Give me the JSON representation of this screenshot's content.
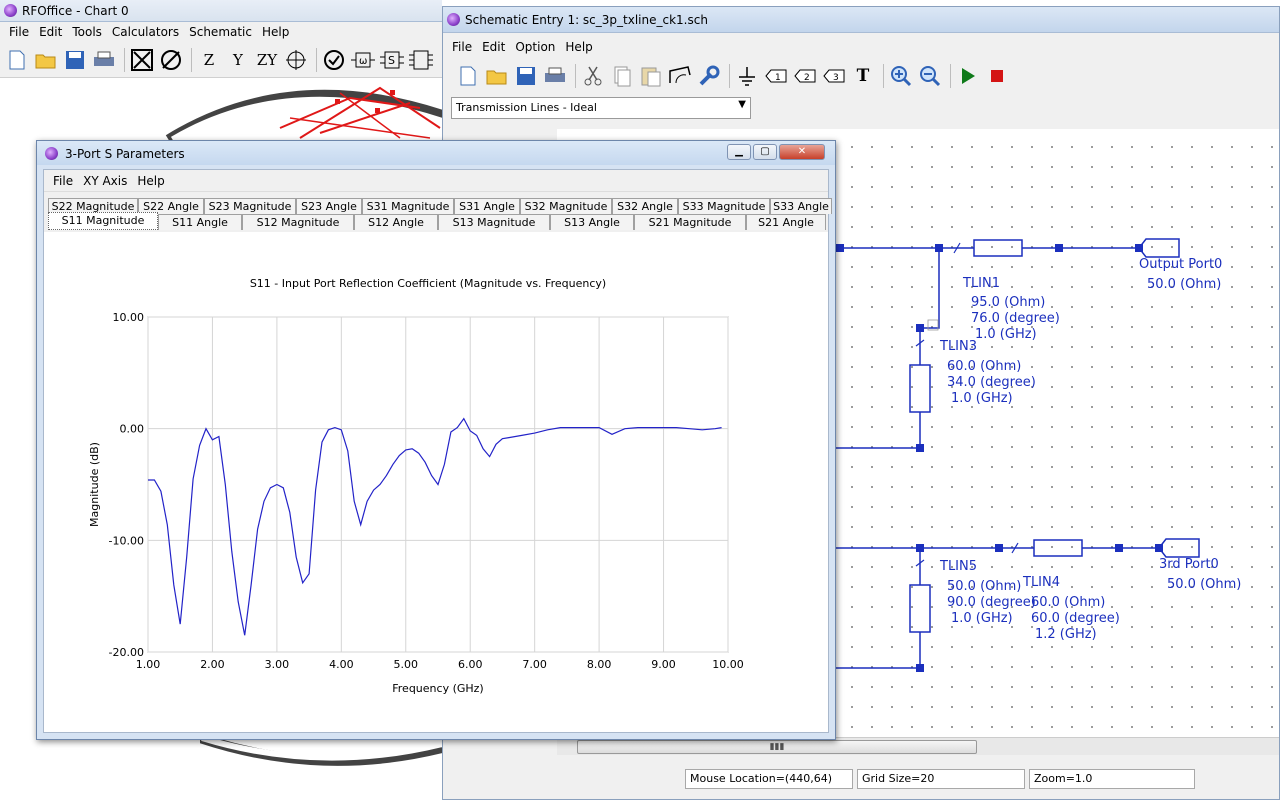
{
  "rfoffice": {
    "title": "RFOffice - Chart 0",
    "menu": [
      "File",
      "Edit",
      "Tools",
      "Calculators",
      "Schematic",
      "Help"
    ],
    "toolbar_text": {
      "z": "Z",
      "y": "Y",
      "zy": "ZY"
    }
  },
  "schematic": {
    "title": "Schematic Entry 1: sc_3p_txline_ck1.sch",
    "menu": [
      "File",
      "Edit",
      "Option",
      "Help"
    ],
    "component_select": "Transmission Lines - Ideal",
    "status": {
      "mouse": "Mouse Location=(440,64)",
      "grid": "Grid Size=20",
      "zoom": "Zoom=1.0"
    },
    "labels": {
      "tlin1": "TLIN1",
      "tlin1_z": "95.0 (Ohm)",
      "tlin1_deg": "76.0 (degree)",
      "tlin1_f": "1.0 (GHz)",
      "tlin3": "TLIN3",
      "tlin3_z": "60.0 (Ohm)",
      "tlin3_deg": "34.0 (degree)",
      "tlin3_f": "1.0 (GHz)",
      "tlin5": "TLIN5",
      "tlin5_z": "50.0 (Ohm)",
      "tlin5_deg": "90.0 (degree)",
      "tlin5_f": "1.0 (GHz)",
      "tlin4": "TLIN4",
      "tlin4_z": "60.0 (Ohm)",
      "tlin4_deg": "60.0 (degree)",
      "tlin4_f": "1.2 (GHz)",
      "out_port": "Output Port0",
      "out_port_z": "50.0 (Ohm)",
      "third_port": "3rd Port0",
      "third_port_z": "50.0 (Ohm)"
    },
    "port_icons": {
      "p1": "1",
      "p2": "2",
      "p3": "3",
      "text": "T"
    }
  },
  "sparams": {
    "title": "3-Port S Parameters",
    "menu": [
      "File",
      "XY Axis",
      "Help"
    ],
    "tabs_row1": [
      "S22 Magnitude",
      "S22 Angle",
      "S23 Magnitude",
      "S23 Angle",
      "S31 Magnitude",
      "S31 Angle",
      "S32 Magnitude",
      "S32 Angle",
      "S33 Magnitude",
      "S33 Angle"
    ],
    "tabs_row2": [
      "S11 Magnitude",
      "S11 Angle",
      "S12 Magnitude",
      "S12 Angle",
      "S13 Magnitude",
      "S13 Angle",
      "S21 Magnitude",
      "S21 Angle"
    ]
  },
  "chart_data": {
    "type": "line",
    "title": "S11 - Input Port Reflection Coefficient (Magnitude vs. Frequency)",
    "xlabel": "Frequency (GHz)",
    "ylabel": "Magnitude (dB)",
    "xlim": [
      1.0,
      10.0
    ],
    "ylim": [
      -20.0,
      10.0
    ],
    "xticks": [
      "1.00",
      "2.00",
      "3.00",
      "4.00",
      "5.00",
      "6.00",
      "7.00",
      "8.00",
      "9.00",
      "10.00"
    ],
    "yticks": [
      "10.00",
      "0.00",
      "-10.00",
      "-20.00"
    ],
    "grid": true,
    "color": "#2323c8",
    "x": [
      1.0,
      1.1,
      1.2,
      1.3,
      1.4,
      1.5,
      1.6,
      1.7,
      1.8,
      1.9,
      2.0,
      2.1,
      2.2,
      2.3,
      2.4,
      2.5,
      2.6,
      2.7,
      2.8,
      2.9,
      3.0,
      3.1,
      3.2,
      3.3,
      3.4,
      3.5,
      3.6,
      3.7,
      3.8,
      3.9,
      4.0,
      4.1,
      4.2,
      4.3,
      4.4,
      4.5,
      4.6,
      4.7,
      4.8,
      4.9,
      5.0,
      5.1,
      5.2,
      5.3,
      5.4,
      5.5,
      5.6,
      5.7,
      5.8,
      5.9,
      6.0,
      6.1,
      6.2,
      6.3,
      6.4,
      6.5,
      6.6,
      6.8,
      7.0,
      7.2,
      7.4,
      7.6,
      7.8,
      8.0,
      8.2,
      8.4,
      8.6,
      8.8,
      9.0,
      9.2,
      9.4,
      9.6,
      9.8,
      9.9
    ],
    "values": [
      -4.6,
      -4.6,
      -5.6,
      -8.6,
      -14.0,
      -17.5,
      -11.5,
      -4.5,
      -1.5,
      0.0,
      -1.0,
      -0.7,
      -5.0,
      -11.0,
      -15.5,
      -18.5,
      -14.0,
      -9.0,
      -6.5,
      -5.3,
      -5.0,
      -5.3,
      -7.5,
      -11.5,
      -13.8,
      -13.0,
      -5.5,
      -1.2,
      -0.1,
      0.1,
      -0.1,
      -2.0,
      -6.5,
      -8.6,
      -6.5,
      -5.5,
      -5.0,
      -4.2,
      -3.2,
      -2.4,
      -1.9,
      -1.8,
      -2.2,
      -3.0,
      -4.2,
      -5.0,
      -3.2,
      -0.3,
      0.1,
      0.9,
      -0.2,
      -0.6,
      -1.8,
      -2.5,
      -1.4,
      -0.9,
      -0.8,
      -0.6,
      -0.4,
      -0.1,
      0.1,
      0.1,
      0.1,
      0.1,
      -0.5,
      0.0,
      0.1,
      0.1,
      0.1,
      0.1,
      0.0,
      -0.1,
      0.0,
      0.1
    ]
  }
}
